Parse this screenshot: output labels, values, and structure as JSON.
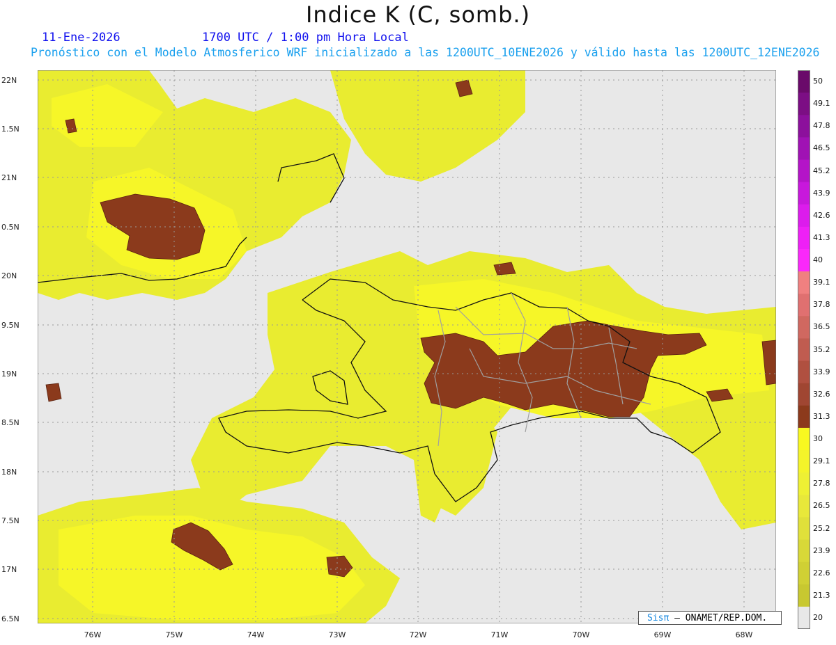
{
  "header": {
    "title": "Indice K (C, somb.)",
    "date": "11-Ene-2026",
    "time": "1700 UTC / 1:00 pm Hora Local",
    "forecast": "Pronóstico con el Modelo Atmosferico WRF inicializado a las 1200UTC_10ENE2026 y válido hasta las  1200UTC_12ENE2026"
  },
  "map": {
    "lat_labels": [
      "22N",
      "1.5N",
      "21N",
      "0.5N",
      "20N",
      "9.5N",
      "19N",
      "8.5N",
      "18N",
      "7.5N",
      "17N",
      "6.5N"
    ],
    "lon_labels": [
      "76W",
      "75W",
      "74W",
      "73W",
      "72W",
      "71W",
      "70W",
      "69W",
      "68W"
    ],
    "colors": {
      "background": "#e8e8e8",
      "low_k": "#e9ec30",
      "mid_k": "#f6f628",
      "high_k": "#8b3a1c",
      "coastline": "#111111",
      "provinces": "#a0a0a0"
    }
  },
  "legend": {
    "labels": [
      "50",
      "49.1",
      "47.8",
      "46.5",
      "45.2",
      "43.9",
      "42.6",
      "41.3",
      "40",
      "39.1",
      "37.8",
      "36.5",
      "35.2",
      "33.9",
      "32.6",
      "31.3",
      "30",
      "29.1",
      "27.8",
      "26.5",
      "25.2",
      "23.9",
      "22.6",
      "21.3",
      "20"
    ],
    "colors": [
      "#6a0a6a",
      "#7c0e84",
      "#8c109c",
      "#a012b4",
      "#b414c8",
      "#c818dc",
      "#dc1cec",
      "#ee20f6",
      "#fa28fa",
      "#f08080",
      "#e07070",
      "#d06860",
      "#c05c50",
      "#b05040",
      "#a04632",
      "#8c3a1c",
      "#f8f820",
      "#f4f42a",
      "#eef034",
      "#e8e83a",
      "#e0e03a",
      "#d8d838",
      "#d0d034",
      "#c8c830",
      "#e8e8e8"
    ]
  },
  "credit": {
    "brand": "Sisπ",
    "text": "– ONAMET/REP.DOM."
  }
}
